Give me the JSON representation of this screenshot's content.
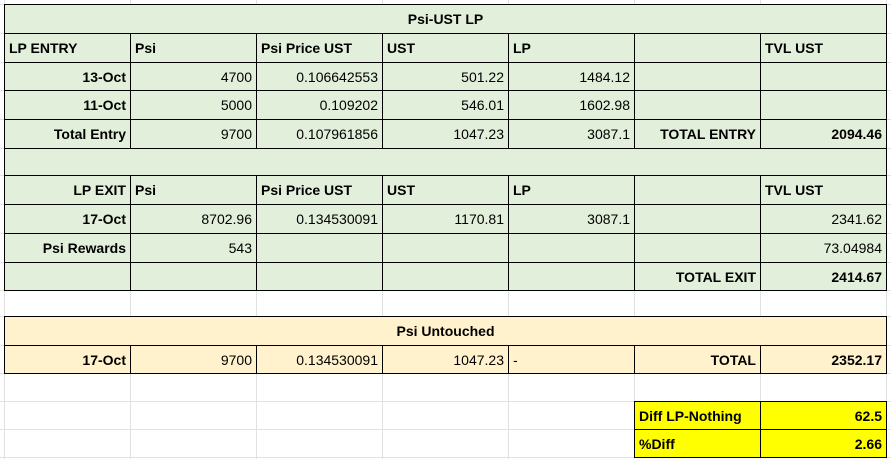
{
  "lp": {
    "title": "Psi-UST LP",
    "entry_header": [
      "LP ENTRY",
      "Psi",
      "Psi Price UST",
      "UST",
      "LP",
      "",
      "TVL UST"
    ],
    "entry_rows": [
      [
        "13-Oct",
        "4700",
        "0.106642553",
        "501.22",
        "1484.12",
        "",
        ""
      ],
      [
        "11-Oct",
        "5000",
        "0.109202",
        "546.01",
        "1602.98",
        "",
        ""
      ],
      [
        "Total Entry",
        "9700",
        "0.107961856",
        "1047.23",
        "3087.1",
        "TOTAL ENTRY",
        "2094.46"
      ]
    ],
    "exit_header": [
      "LP EXIT",
      "Psi",
      "Psi Price UST",
      "UST",
      "LP",
      "",
      "TVL UST"
    ],
    "exit_rows": [
      [
        "17-Oct",
        "8702.96",
        "0.134530091",
        "1170.81",
        "3087.1",
        "",
        "2341.62"
      ],
      [
        "Psi Rewards",
        "543",
        "",
        "",
        "",
        "",
        "73.04984"
      ],
      [
        "",
        "",
        "",
        "",
        "",
        "TOTAL EXIT",
        "2414.67"
      ]
    ]
  },
  "untouched": {
    "title": "Psi Untouched",
    "row": [
      "17-Oct",
      "9700",
      "0.134530091",
      "1047.23",
      "-",
      "TOTAL",
      "2352.17"
    ]
  },
  "summary": {
    "rows": [
      [
        "Diff LP-Nothing",
        "62.5"
      ],
      [
        "%Diff",
        "2.66"
      ]
    ]
  }
}
